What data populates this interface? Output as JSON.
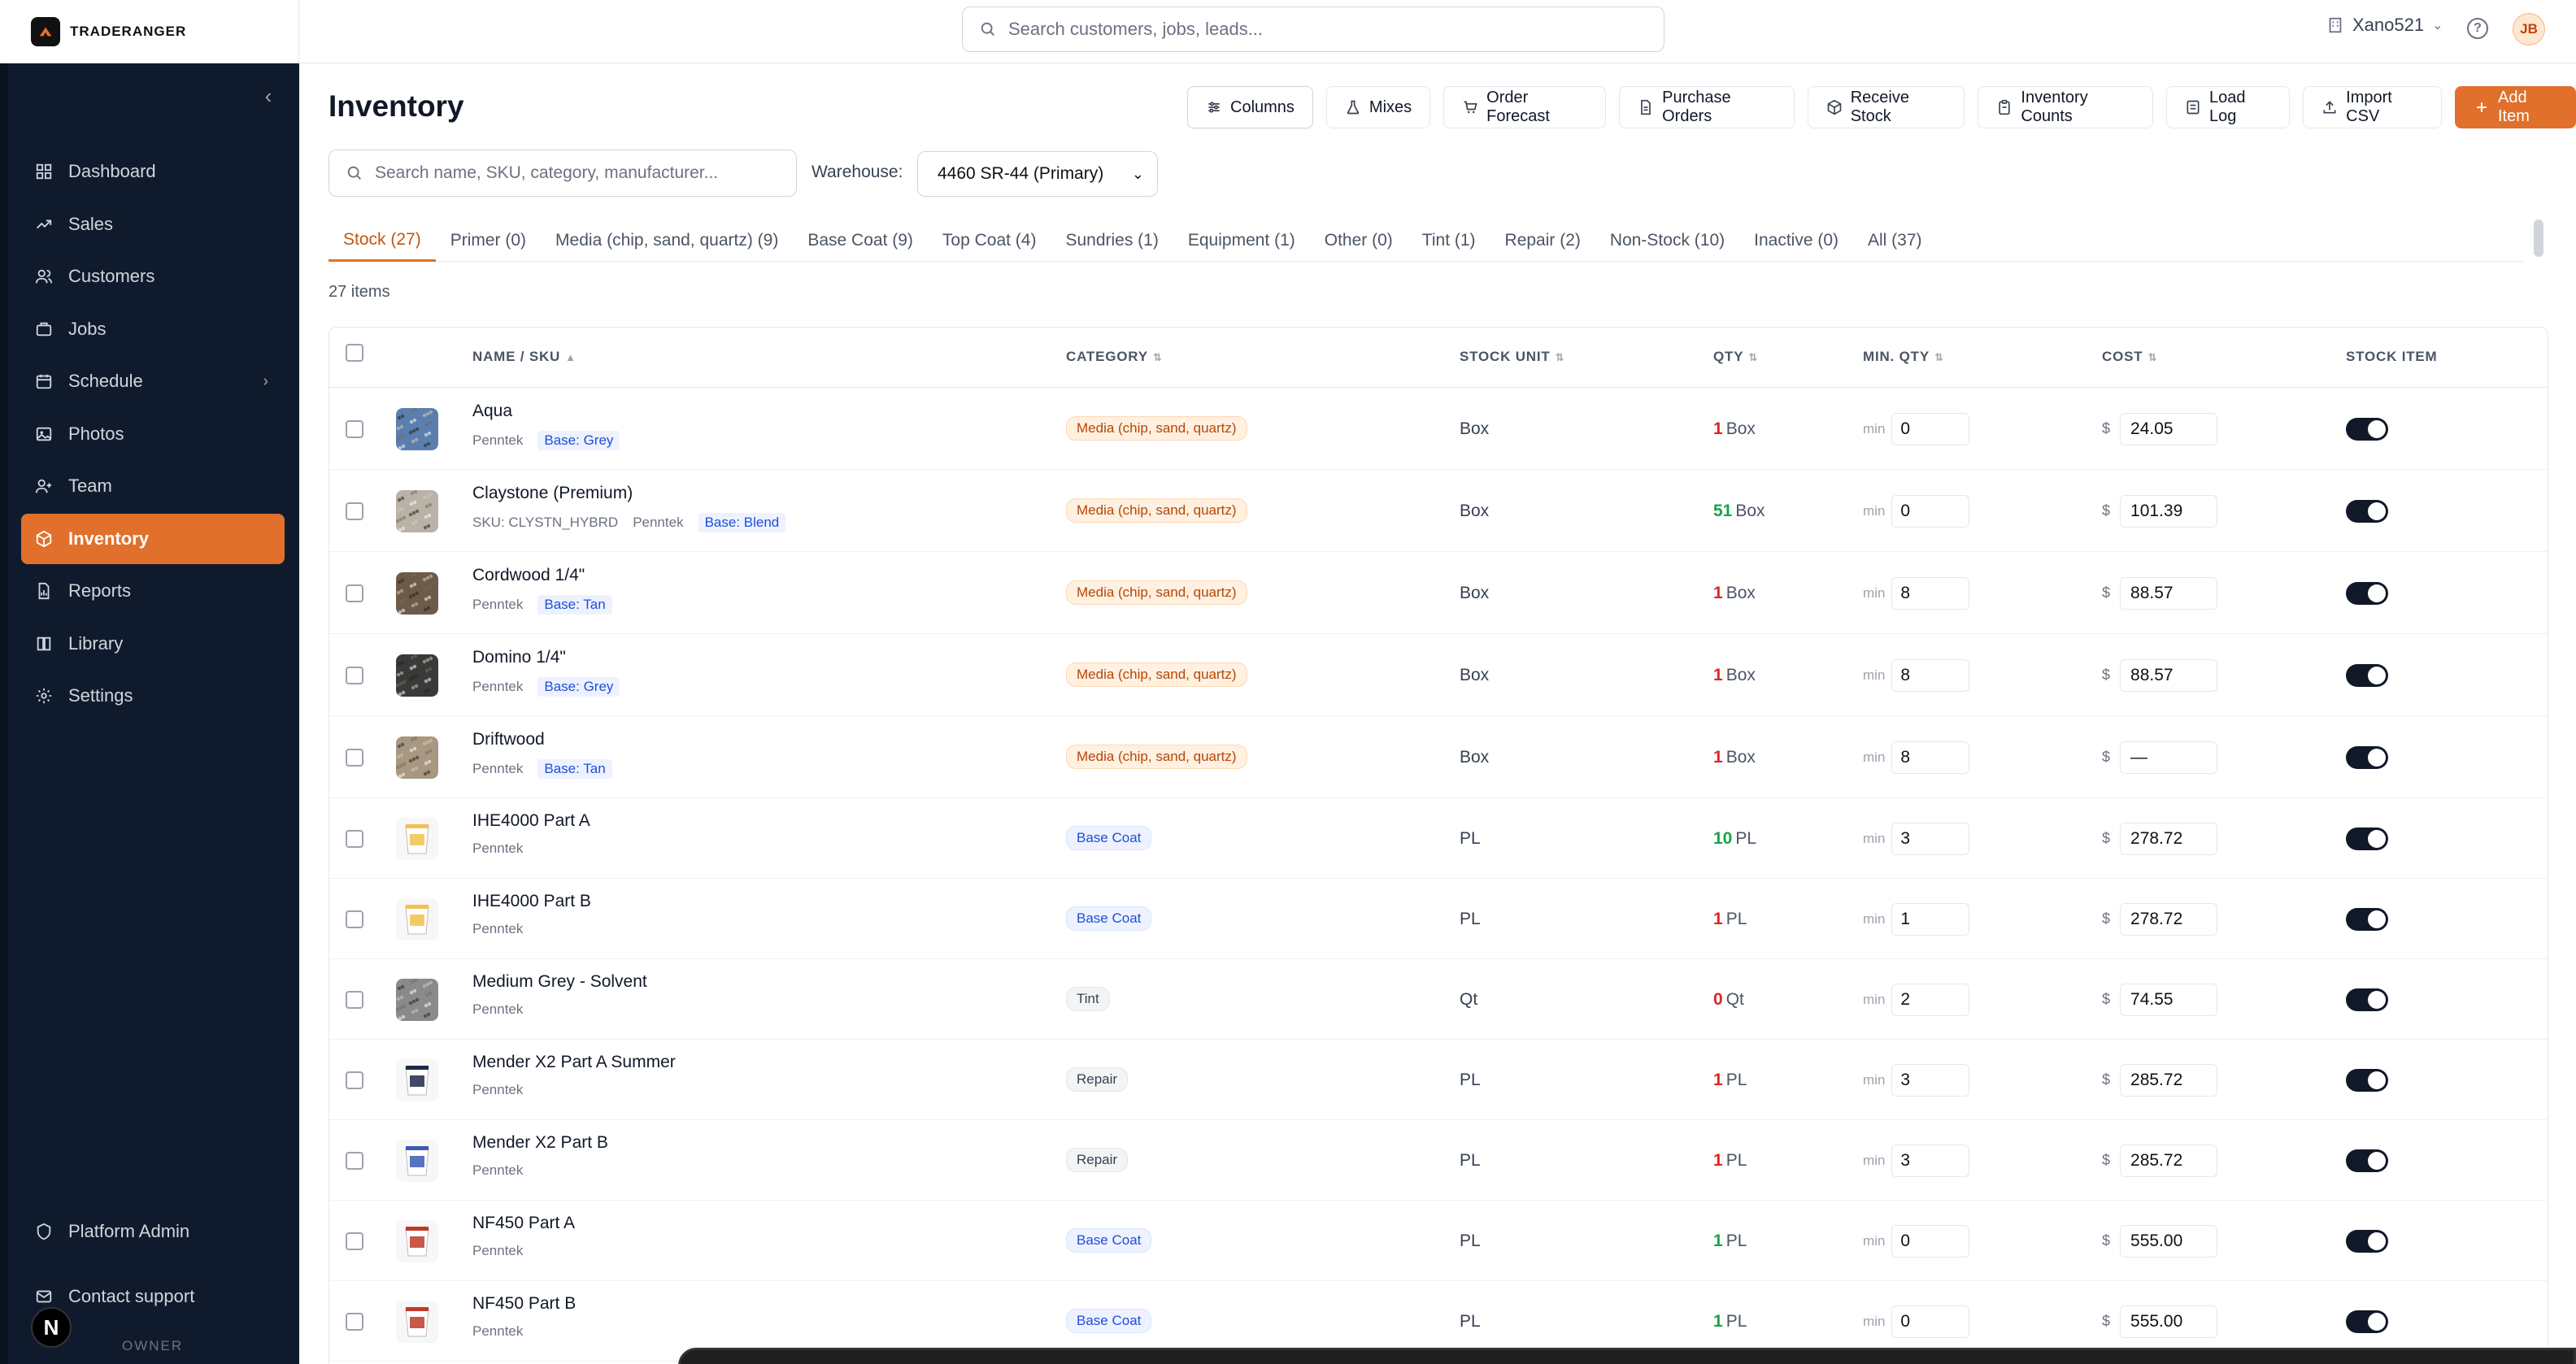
{
  "brand": {
    "name": "TRADERANGER"
  },
  "search": {
    "placeholder": "Search customers, jobs, leads..."
  },
  "account": {
    "name": "Xano521",
    "initials": "JB"
  },
  "sidebar": {
    "items": [
      {
        "label": "Dashboard",
        "icon": "grid-icon"
      },
      {
        "label": "Sales",
        "icon": "trend-icon"
      },
      {
        "label": "Customers",
        "icon": "users-icon"
      },
      {
        "label": "Jobs",
        "icon": "briefcase-icon"
      },
      {
        "label": "Schedule",
        "icon": "calendar-icon"
      },
      {
        "label": "Photos",
        "icon": "image-icon"
      },
      {
        "label": "Team",
        "icon": "user-plus-icon"
      },
      {
        "label": "Inventory",
        "icon": "box-icon",
        "active": true
      },
      {
        "label": "Reports",
        "icon": "file-chart-icon"
      },
      {
        "label": "Library",
        "icon": "book-icon"
      },
      {
        "label": "Settings",
        "icon": "gear-icon"
      }
    ],
    "bottom": [
      {
        "label": "Platform Admin",
        "icon": "shield-icon"
      },
      {
        "label": "Contact support",
        "icon": "mail-icon"
      }
    ],
    "role": "OWNER",
    "badge": "N"
  },
  "page": {
    "title": "Inventory",
    "item_count": "27 items"
  },
  "toolbar": {
    "columns": "Columns",
    "mixes": "Mixes",
    "order_forecast": "Order Forecast",
    "purchase_orders": "Purchase Orders",
    "receive_stock": "Receive Stock",
    "inventory_counts": "Inventory Counts",
    "load_log": "Load Log",
    "import_csv": "Import CSV",
    "add_item": "Add Item"
  },
  "filters": {
    "search_placeholder": "Search name, SKU, category, manufacturer...",
    "warehouse_label": "Warehouse:",
    "warehouse_value": "4460 SR-44 (Primary)"
  },
  "tabs": [
    "Stock (27)",
    "Primer (0)",
    "Media (chip, sand, quartz) (9)",
    "Base Coat (9)",
    "Top Coat (4)",
    "Sundries (1)",
    "Equipment (1)",
    "Other (0)",
    "Tint (1)",
    "Repair (2)",
    "Non-Stock (10)",
    "Inactive (0)",
    "All (37)"
  ],
  "table": {
    "headers": {
      "name": "NAME / SKU",
      "category": "CATEGORY",
      "unit": "STOCK UNIT",
      "qty": "QTY",
      "min": "MIN. QTY",
      "cost": "COST",
      "stock": "STOCK ITEM"
    },
    "min_label": "min",
    "currency": "$",
    "rows": [
      {
        "name": "Aqua",
        "sku": "",
        "mfr": "Penntek",
        "base": "Base: Grey",
        "category": "Media (chip, sand, quartz)",
        "cat_style": "media",
        "unit": "Box",
        "qty": "1",
        "qty_unit": "Box",
        "qty_color": "red",
        "min": "0",
        "cost": "24.05",
        "thumb": "#5a7fae"
      },
      {
        "name": "Claystone (Premium)",
        "sku": "SKU: CLYSTN_HYBRD",
        "mfr": "Penntek",
        "base": "Base: Blend",
        "category": "Media (chip, sand, quartz)",
        "cat_style": "media",
        "unit": "Box",
        "qty": "51",
        "qty_unit": "Box",
        "qty_color": "green",
        "min": "0",
        "cost": "101.39",
        "thumb": "#b9b2a6"
      },
      {
        "name": "Cordwood 1/4\"",
        "sku": "",
        "mfr": "Penntek",
        "base": "Base: Tan",
        "category": "Media (chip, sand, quartz)",
        "cat_style": "media",
        "unit": "Box",
        "qty": "1",
        "qty_unit": "Box",
        "qty_color": "red",
        "min": "8",
        "cost": "88.57",
        "thumb": "#6e5a48"
      },
      {
        "name": "Domino 1/4\"",
        "sku": "",
        "mfr": "Penntek",
        "base": "Base: Grey",
        "category": "Media (chip, sand, quartz)",
        "cat_style": "media",
        "unit": "Box",
        "qty": "1",
        "qty_unit": "Box",
        "qty_color": "red",
        "min": "8",
        "cost": "88.57",
        "thumb": "#3a3a3a"
      },
      {
        "name": "Driftwood",
        "sku": "",
        "mfr": "Penntek",
        "base": "Base: Tan",
        "category": "Media (chip, sand, quartz)",
        "cat_style": "media",
        "unit": "Box",
        "qty": "1",
        "qty_unit": "Box",
        "qty_color": "red",
        "min": "8",
        "cost": "—",
        "thumb": "#a89882"
      },
      {
        "name": "IHE4000 Part A",
        "sku": "",
        "mfr": "Penntek",
        "base": "",
        "category": "Base Coat",
        "cat_style": "base",
        "unit": "PL",
        "qty": "10",
        "qty_unit": "PL",
        "qty_color": "green",
        "min": "3",
        "cost": "278.72",
        "thumb": "bucket-yellow"
      },
      {
        "name": "IHE4000 Part B",
        "sku": "",
        "mfr": "Penntek",
        "base": "",
        "category": "Base Coat",
        "cat_style": "base",
        "unit": "PL",
        "qty": "1",
        "qty_unit": "PL",
        "qty_color": "red",
        "min": "1",
        "cost": "278.72",
        "thumb": "bucket-yellow"
      },
      {
        "name": "Medium Grey - Solvent",
        "sku": "",
        "mfr": "Penntek",
        "base": "",
        "category": "Tint",
        "cat_style": "neutral",
        "unit": "Qt",
        "qty": "0",
        "qty_unit": "Qt",
        "qty_color": "red",
        "min": "2",
        "cost": "74.55",
        "thumb": "#8a8a8a"
      },
      {
        "name": "Mender X2 Part A Summer",
        "sku": "",
        "mfr": "Penntek",
        "base": "",
        "category": "Repair",
        "cat_style": "neutral",
        "unit": "PL",
        "qty": "1",
        "qty_unit": "PL",
        "qty_color": "red",
        "min": "3",
        "cost": "285.72",
        "thumb": "bucket-dark"
      },
      {
        "name": "Mender X2 Part B",
        "sku": "",
        "mfr": "Penntek",
        "base": "",
        "category": "Repair",
        "cat_style": "neutral",
        "unit": "PL",
        "qty": "1",
        "qty_unit": "PL",
        "qty_color": "red",
        "min": "3",
        "cost": "285.72",
        "thumb": "bucket-blue"
      },
      {
        "name": "NF450 Part A",
        "sku": "",
        "mfr": "Penntek",
        "base": "",
        "category": "Base Coat",
        "cat_style": "base",
        "unit": "PL",
        "qty": "1",
        "qty_unit": "PL",
        "qty_color": "green",
        "min": "0",
        "cost": "555.00",
        "thumb": "bucket-red"
      },
      {
        "name": "NF450 Part B",
        "sku": "",
        "mfr": "Penntek",
        "base": "",
        "category": "Base Coat",
        "cat_style": "base",
        "unit": "PL",
        "qty": "1",
        "qty_unit": "PL",
        "qty_color": "green",
        "min": "0",
        "cost": "555.00",
        "thumb": "bucket-red"
      }
    ]
  },
  "colors": {
    "accent": "#e0702b",
    "sidebar": "#0f1b2d",
    "qty_low": "#dc2626",
    "qty_ok": "#16a34a"
  }
}
